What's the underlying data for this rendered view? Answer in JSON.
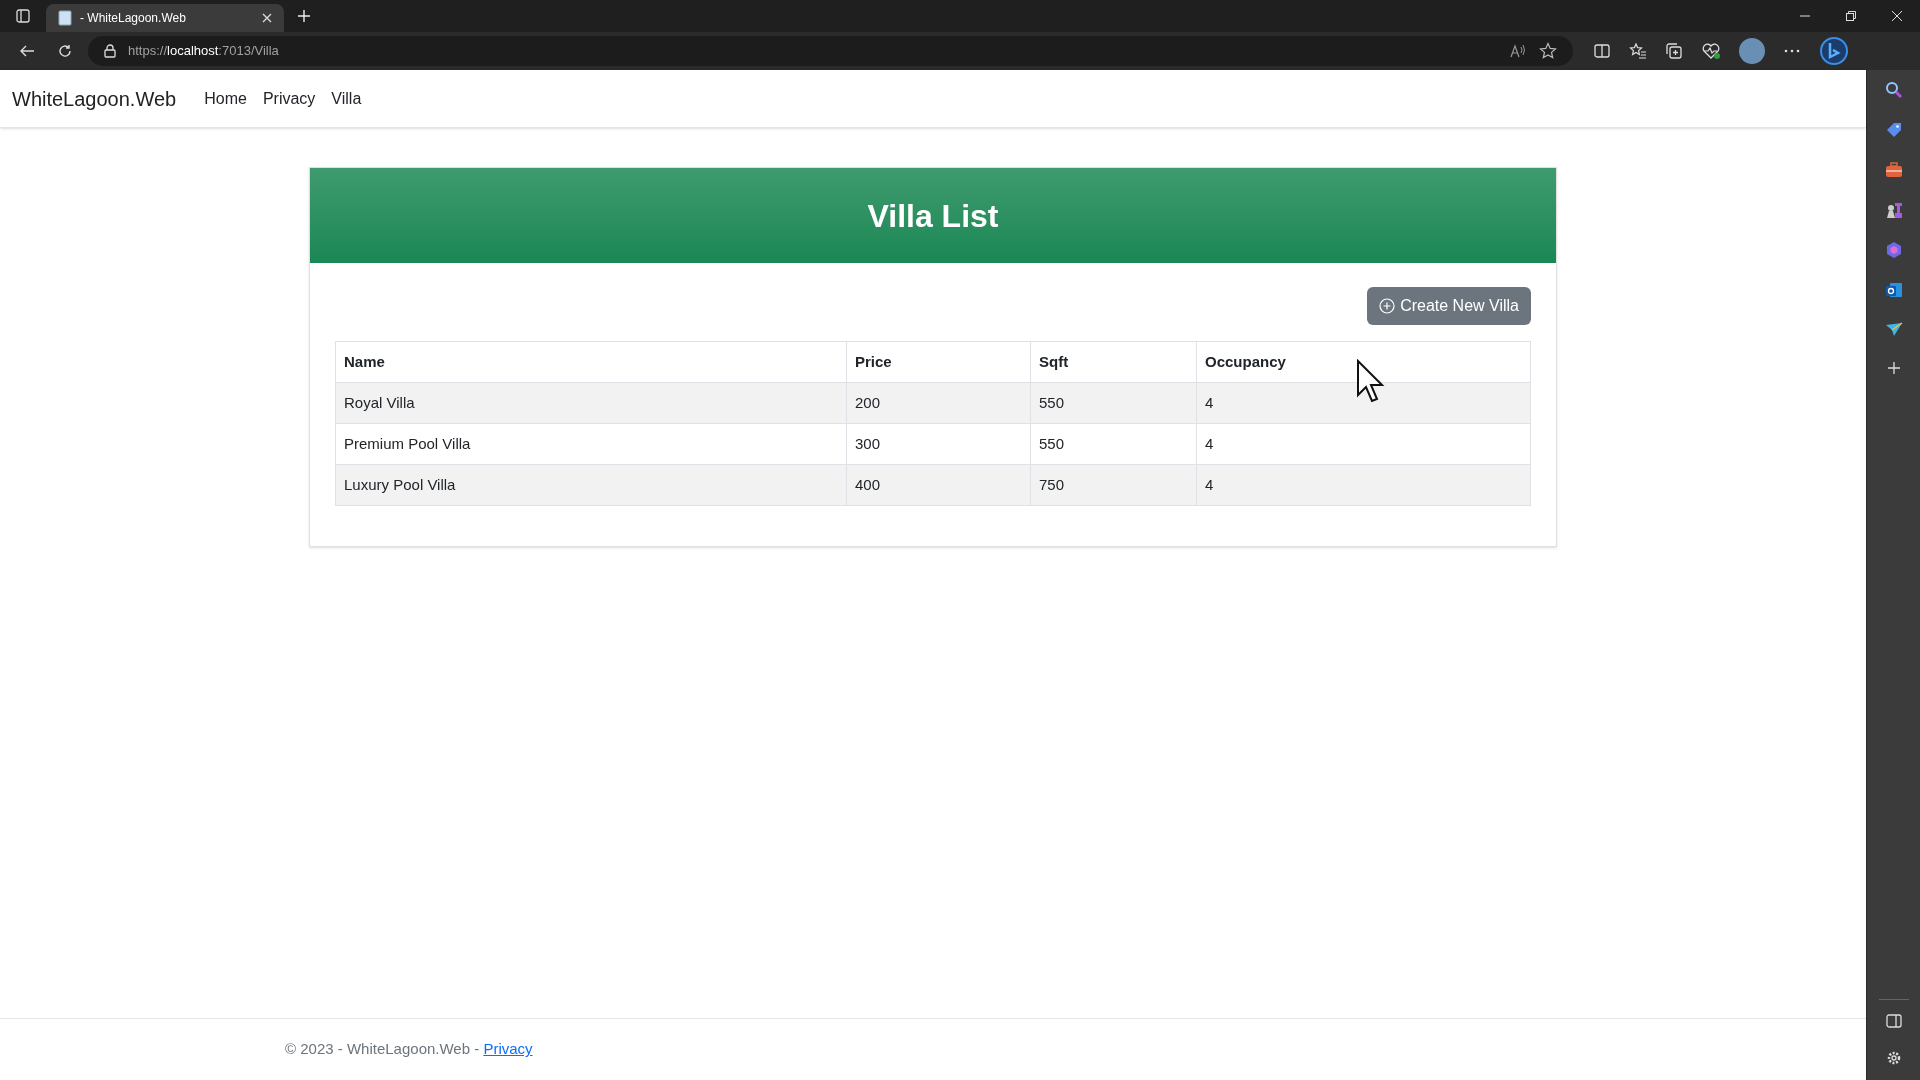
{
  "browser": {
    "tab": {
      "title": "- WhiteLagoon.Web",
      "selected": true
    },
    "url": {
      "scheme": "https://",
      "host": "localhost",
      "path": ":7013/Villa"
    }
  },
  "navbar": {
    "brand": "WhiteLagoon.Web",
    "links": [
      "Home",
      "Privacy",
      "Villa"
    ]
  },
  "card": {
    "title": "Villa List",
    "button": "Create New Villa"
  },
  "table": {
    "columns": [
      "Name",
      "Price",
      "Sqft",
      "Occupancy"
    ],
    "rows": [
      [
        "Royal Villa",
        "200",
        "550",
        "4"
      ],
      [
        "Premium Pool Villa",
        "300",
        "550",
        "4"
      ],
      [
        "Luxury Pool Villa",
        "400",
        "750",
        "4"
      ]
    ]
  },
  "footer": {
    "text": "© 2023 - WhiteLagoon.Web -",
    "link": "Privacy"
  }
}
